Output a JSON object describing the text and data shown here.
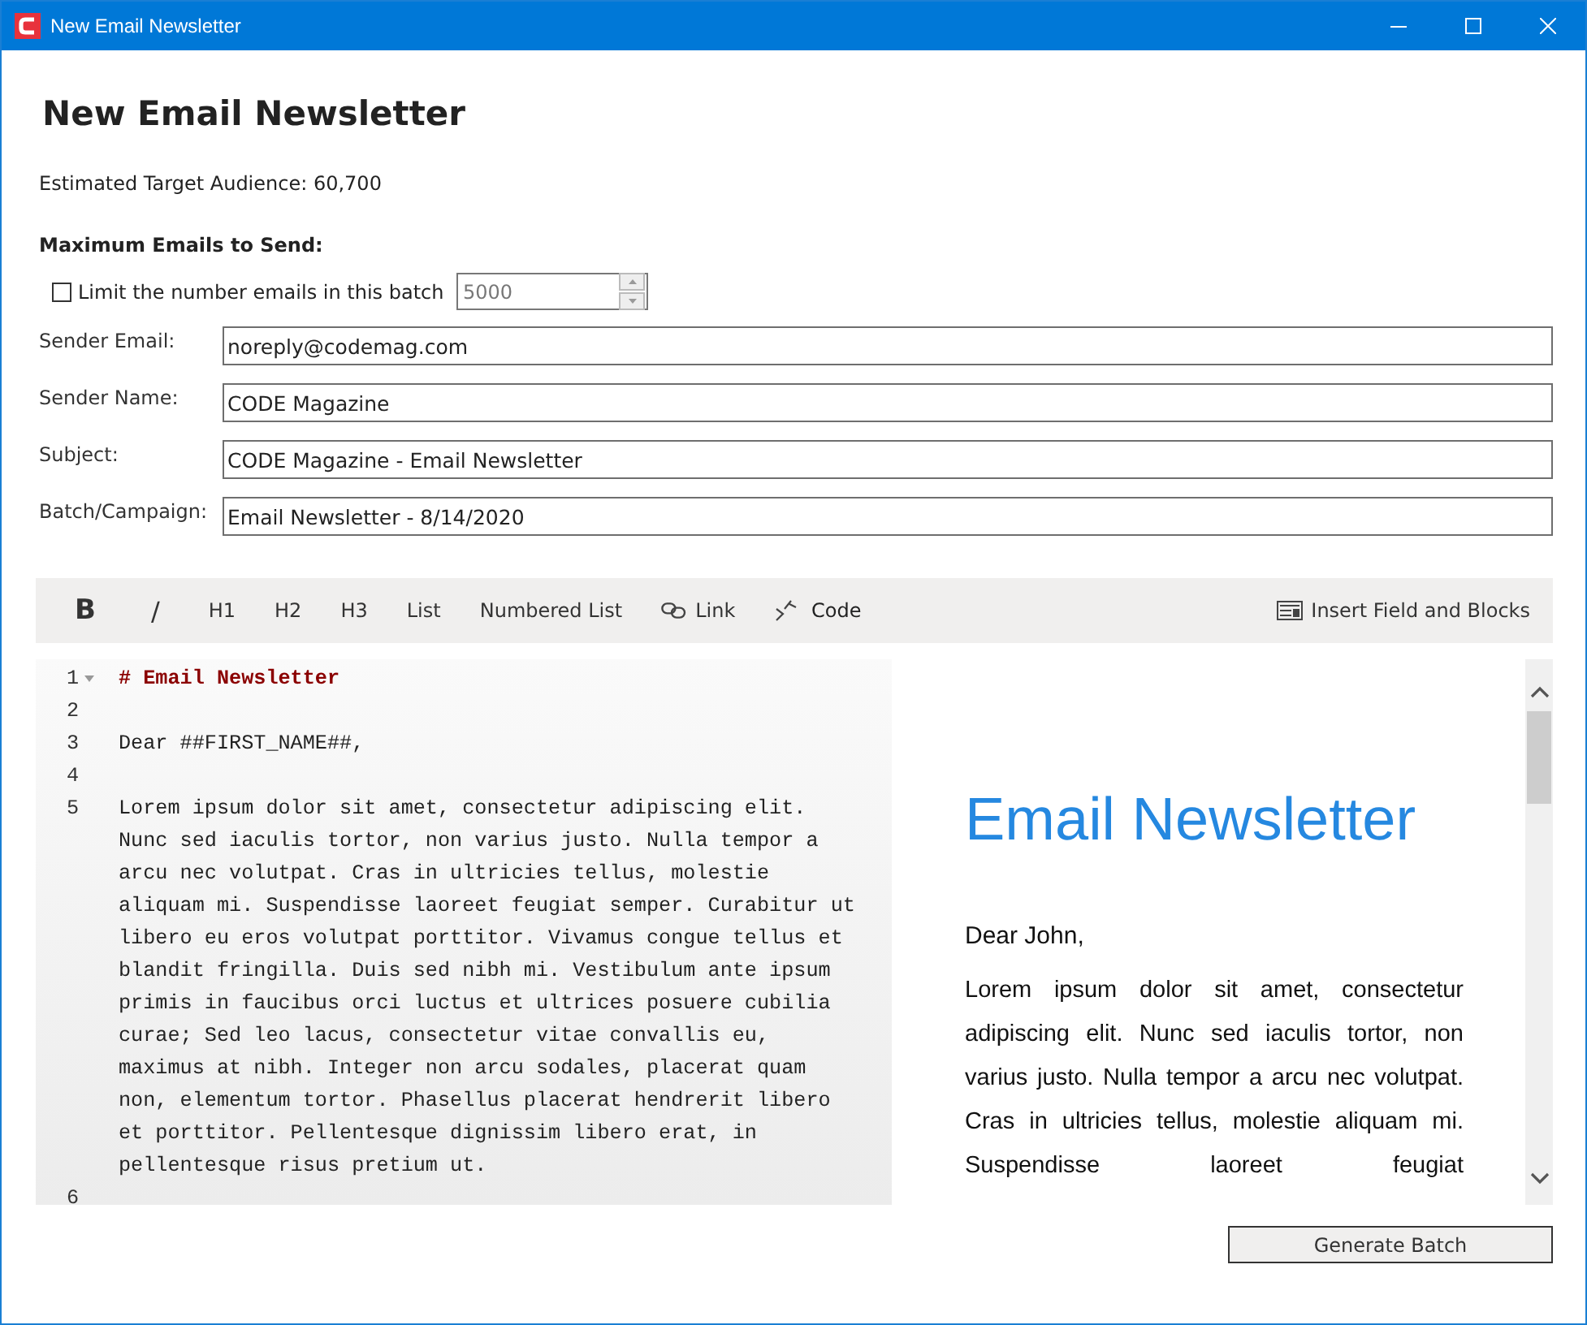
{
  "window": {
    "title": "New Email Newsletter"
  },
  "heading": "New Email Newsletter",
  "audience": "Estimated Target Audience: 60,700",
  "max_section": {
    "label": "Maximum Emails to Send:",
    "limit_label": "Limit the number emails in this batch",
    "limit_checked": false,
    "count": "5000"
  },
  "fields": [
    {
      "label": "Sender Email:",
      "value": "noreply@codemag.com"
    },
    {
      "label": "Sender Name:",
      "value": "CODE Magazine"
    },
    {
      "label": "Subject:",
      "value": "CODE Magazine - Email Newsletter"
    },
    {
      "label": "Batch/Campaign:",
      "value": "Email Newsletter - 8/14/2020"
    }
  ],
  "toolbar": [
    {
      "kind": "bold",
      "label": "B"
    },
    {
      "kind": "italic",
      "label": "/"
    },
    {
      "kind": "text",
      "label": "H1"
    },
    {
      "kind": "text",
      "label": "H2"
    },
    {
      "kind": "text",
      "label": "H3"
    },
    {
      "kind": "text",
      "label": "List"
    },
    {
      "kind": "text",
      "label": "Numbered List"
    },
    {
      "kind": "link",
      "label": "Link"
    },
    {
      "kind": "code",
      "label": "Code"
    },
    {
      "kind": "insert",
      "label": "Insert Field and Blocks"
    }
  ],
  "editor": {
    "lines": [
      {
        "number": "1",
        "kind": "heading",
        "text": "# Email Newsletter",
        "foldable": true
      },
      {
        "number": "2",
        "foldable": false
      },
      {
        "number": "3",
        "kind": "plain",
        "text": "Dear ##FIRST_NAME##,",
        "foldable": false
      },
      {
        "number": "4",
        "foldable": false
      },
      {
        "number": "5",
        "kind": "plain",
        "text": "Lorem ipsum dolor sit amet, consectetur adipiscing elit. Nunc sed iaculis tortor, non varius justo. Nulla tempor a arcu nec volutpat. Cras in ultricies tellus, molestie aliquam mi. Suspendisse laoreet feugiat semper. Curabitur ut libero eu eros volutpat porttitor. Vivamus congue tellus et blandit fringilla. Duis sed nibh mi. Vestibulum ante ipsum primis in faucibus orci luctus et ultrices posuere cubilia curae; Sed leo lacus, consectetur vitae convallis eu, maximus at nibh. Integer non arcu sodales, placerat quam non, elementum tortor. Phasellus placerat hendrerit libero et porttitor. Pellentesque dignissim libero erat, in pellentesque risus pretium ut.",
        "foldable": false
      },
      {
        "number": "6",
        "foldable": false
      }
    ]
  },
  "preview": {
    "heading": "Email Newsletter",
    "greeting": "Dear John,",
    "body": "Lorem ipsum dolor sit amet, consectetur adipiscing elit. Nunc sed iaculis tortor, non varius justo. Nulla tempor a arcu nec volutpat. Cras in ultricies tellus, molestie aliquam mi. Suspendisse laoreet feugiat"
  },
  "buttons": [
    "Generate Batch"
  ]
}
